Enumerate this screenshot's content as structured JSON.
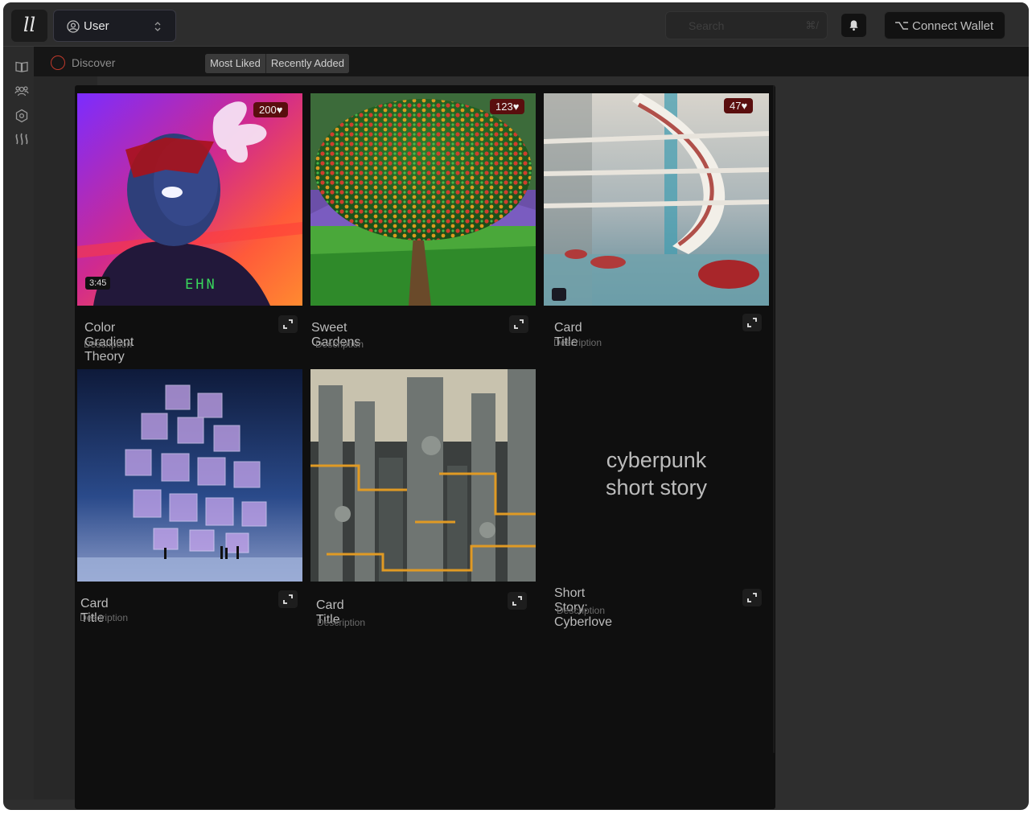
{
  "header": {
    "logo_text": "ll",
    "user_label": "User",
    "search_placeholder": "Search",
    "search_shortcut": "⌘/",
    "wallet_label": "Connect Wallet"
  },
  "sidebar": {
    "items": [
      {
        "icon": "book-icon"
      },
      {
        "icon": "users-icon"
      },
      {
        "icon": "hexagon-settings-icon"
      },
      {
        "icon": "steem-icon"
      }
    ]
  },
  "subnav": {
    "section": "Discover",
    "filters": [
      "Most Liked",
      "Recently Added"
    ]
  },
  "cards": [
    {
      "title": "Color Gradient Theory",
      "description": "Description",
      "likes": "200",
      "duration": "3:45",
      "overlay_text": "EHN"
    },
    {
      "title": "Sweet Gardens",
      "description": "Description",
      "likes": "123"
    },
    {
      "title": "Card Title",
      "description": "Description",
      "likes": "47"
    },
    {
      "title": "Card Title",
      "description": "Description"
    },
    {
      "title": "Card Title",
      "description": "Description"
    },
    {
      "title": "Short Story: Cyberlove",
      "description": "Description",
      "story_line1": "cyberpunk",
      "story_line2": "short story"
    }
  ],
  "colors": {
    "background": "#2e2e2e",
    "gallery": "#0f0f0f",
    "like_badge": "#5a0e0e",
    "discover_ring": "#c0392b"
  }
}
